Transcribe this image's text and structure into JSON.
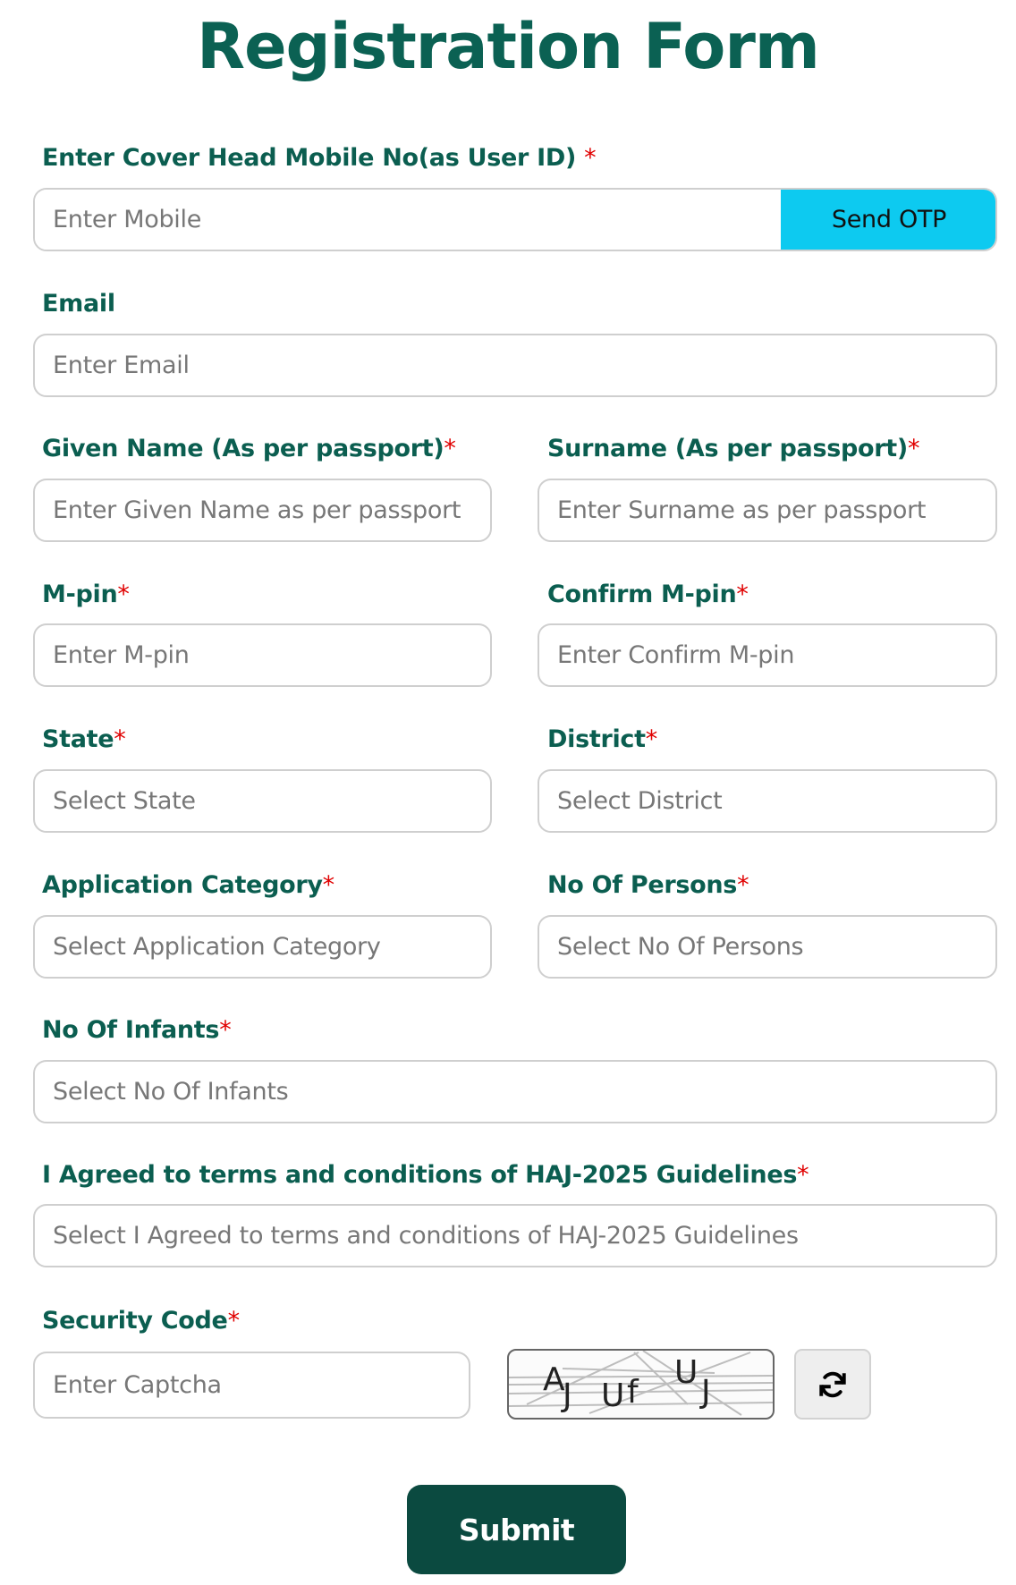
{
  "page": {
    "title": "Registration Form"
  },
  "colors": {
    "brand_green": "#0b6153",
    "required_red": "#e00000",
    "otp_cyan": "#0dcaf0",
    "submit_bg": "#0b4a40"
  },
  "form": {
    "mobile": {
      "label": "Enter Cover Head Mobile No(as User ID) ",
      "required": "*",
      "placeholder": "Enter Mobile",
      "value": "",
      "send_otp_label": "Send OTP"
    },
    "email": {
      "label": "Email",
      "placeholder": "Enter Email",
      "value": ""
    },
    "given_name": {
      "label": "Given Name (As per passport)",
      "required": "*",
      "placeholder": "Enter Given Name as per passport",
      "value": ""
    },
    "surname": {
      "label": "Surname (As per passport)",
      "required": "*",
      "placeholder": "Enter Surname as per passport",
      "value": ""
    },
    "mpin": {
      "label": "M-pin",
      "required": "*",
      "placeholder": "Enter M-pin",
      "value": ""
    },
    "confirm_mpin": {
      "label": "Confirm M-pin",
      "required": "*",
      "placeholder": "Enter Confirm M-pin",
      "value": ""
    },
    "state": {
      "label": "State",
      "required": "*",
      "selected": "Select State"
    },
    "district": {
      "label": "District",
      "required": "*",
      "selected": "Select District"
    },
    "application_category": {
      "label": "Application Category",
      "required": "*",
      "selected": "Select Application Category"
    },
    "no_of_persons": {
      "label": "No Of Persons",
      "required": "*",
      "selected": "Select No Of Persons"
    },
    "no_of_infants": {
      "label": "No Of Infants",
      "required": "*",
      "selected": "Select No Of Infants"
    },
    "agreement": {
      "label": "I Agreed to terms and conditions of HAJ-2025 Guidelines",
      "required": "*",
      "selected": "Select I Agreed to terms and conditions of HAJ-2025 Guidelines"
    },
    "security_code": {
      "label": "Security Code",
      "required": "*",
      "placeholder": "Enter Captcha",
      "value": "",
      "captcha_chars": [
        "A",
        "J",
        "U",
        "f",
        "U",
        "J"
      ],
      "refresh_icon": "sync-icon"
    },
    "submit_label": "Submit"
  }
}
